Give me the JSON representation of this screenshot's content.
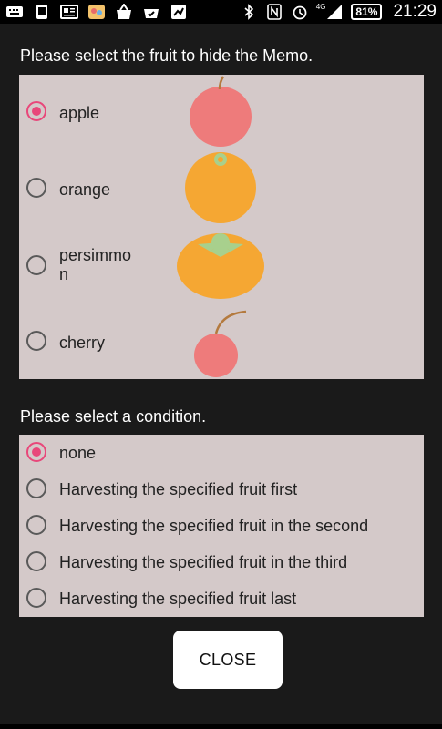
{
  "status_bar": {
    "network": "4G",
    "battery": "81%",
    "time": "21:29"
  },
  "fruit_section": {
    "heading": "Please select the fruit to hide the Memo.",
    "options": [
      {
        "label": "apple",
        "selected": true
      },
      {
        "label": "orange",
        "selected": false
      },
      {
        "label": "persimmo\nn",
        "selected": false
      },
      {
        "label": "cherry",
        "selected": false
      }
    ]
  },
  "condition_section": {
    "heading": "Please select a condition.",
    "options": [
      {
        "label": "none",
        "selected": true
      },
      {
        "label": "Harvesting the specified fruit first",
        "selected": false
      },
      {
        "label": "Harvesting the specified fruit in the second",
        "selected": false
      },
      {
        "label": "Harvesting the specified fruit in the third",
        "selected": false
      },
      {
        "label": "Harvesting the specified fruit last",
        "selected": false
      }
    ]
  },
  "close_button": {
    "label": "CLOSE"
  },
  "colors": {
    "accent": "#e8477a",
    "panel": "#d4c9c9",
    "apple": "#ee7b7b",
    "orange": "#f5a733",
    "leaf": "#a8d08d",
    "stem": "#b47a3e"
  }
}
